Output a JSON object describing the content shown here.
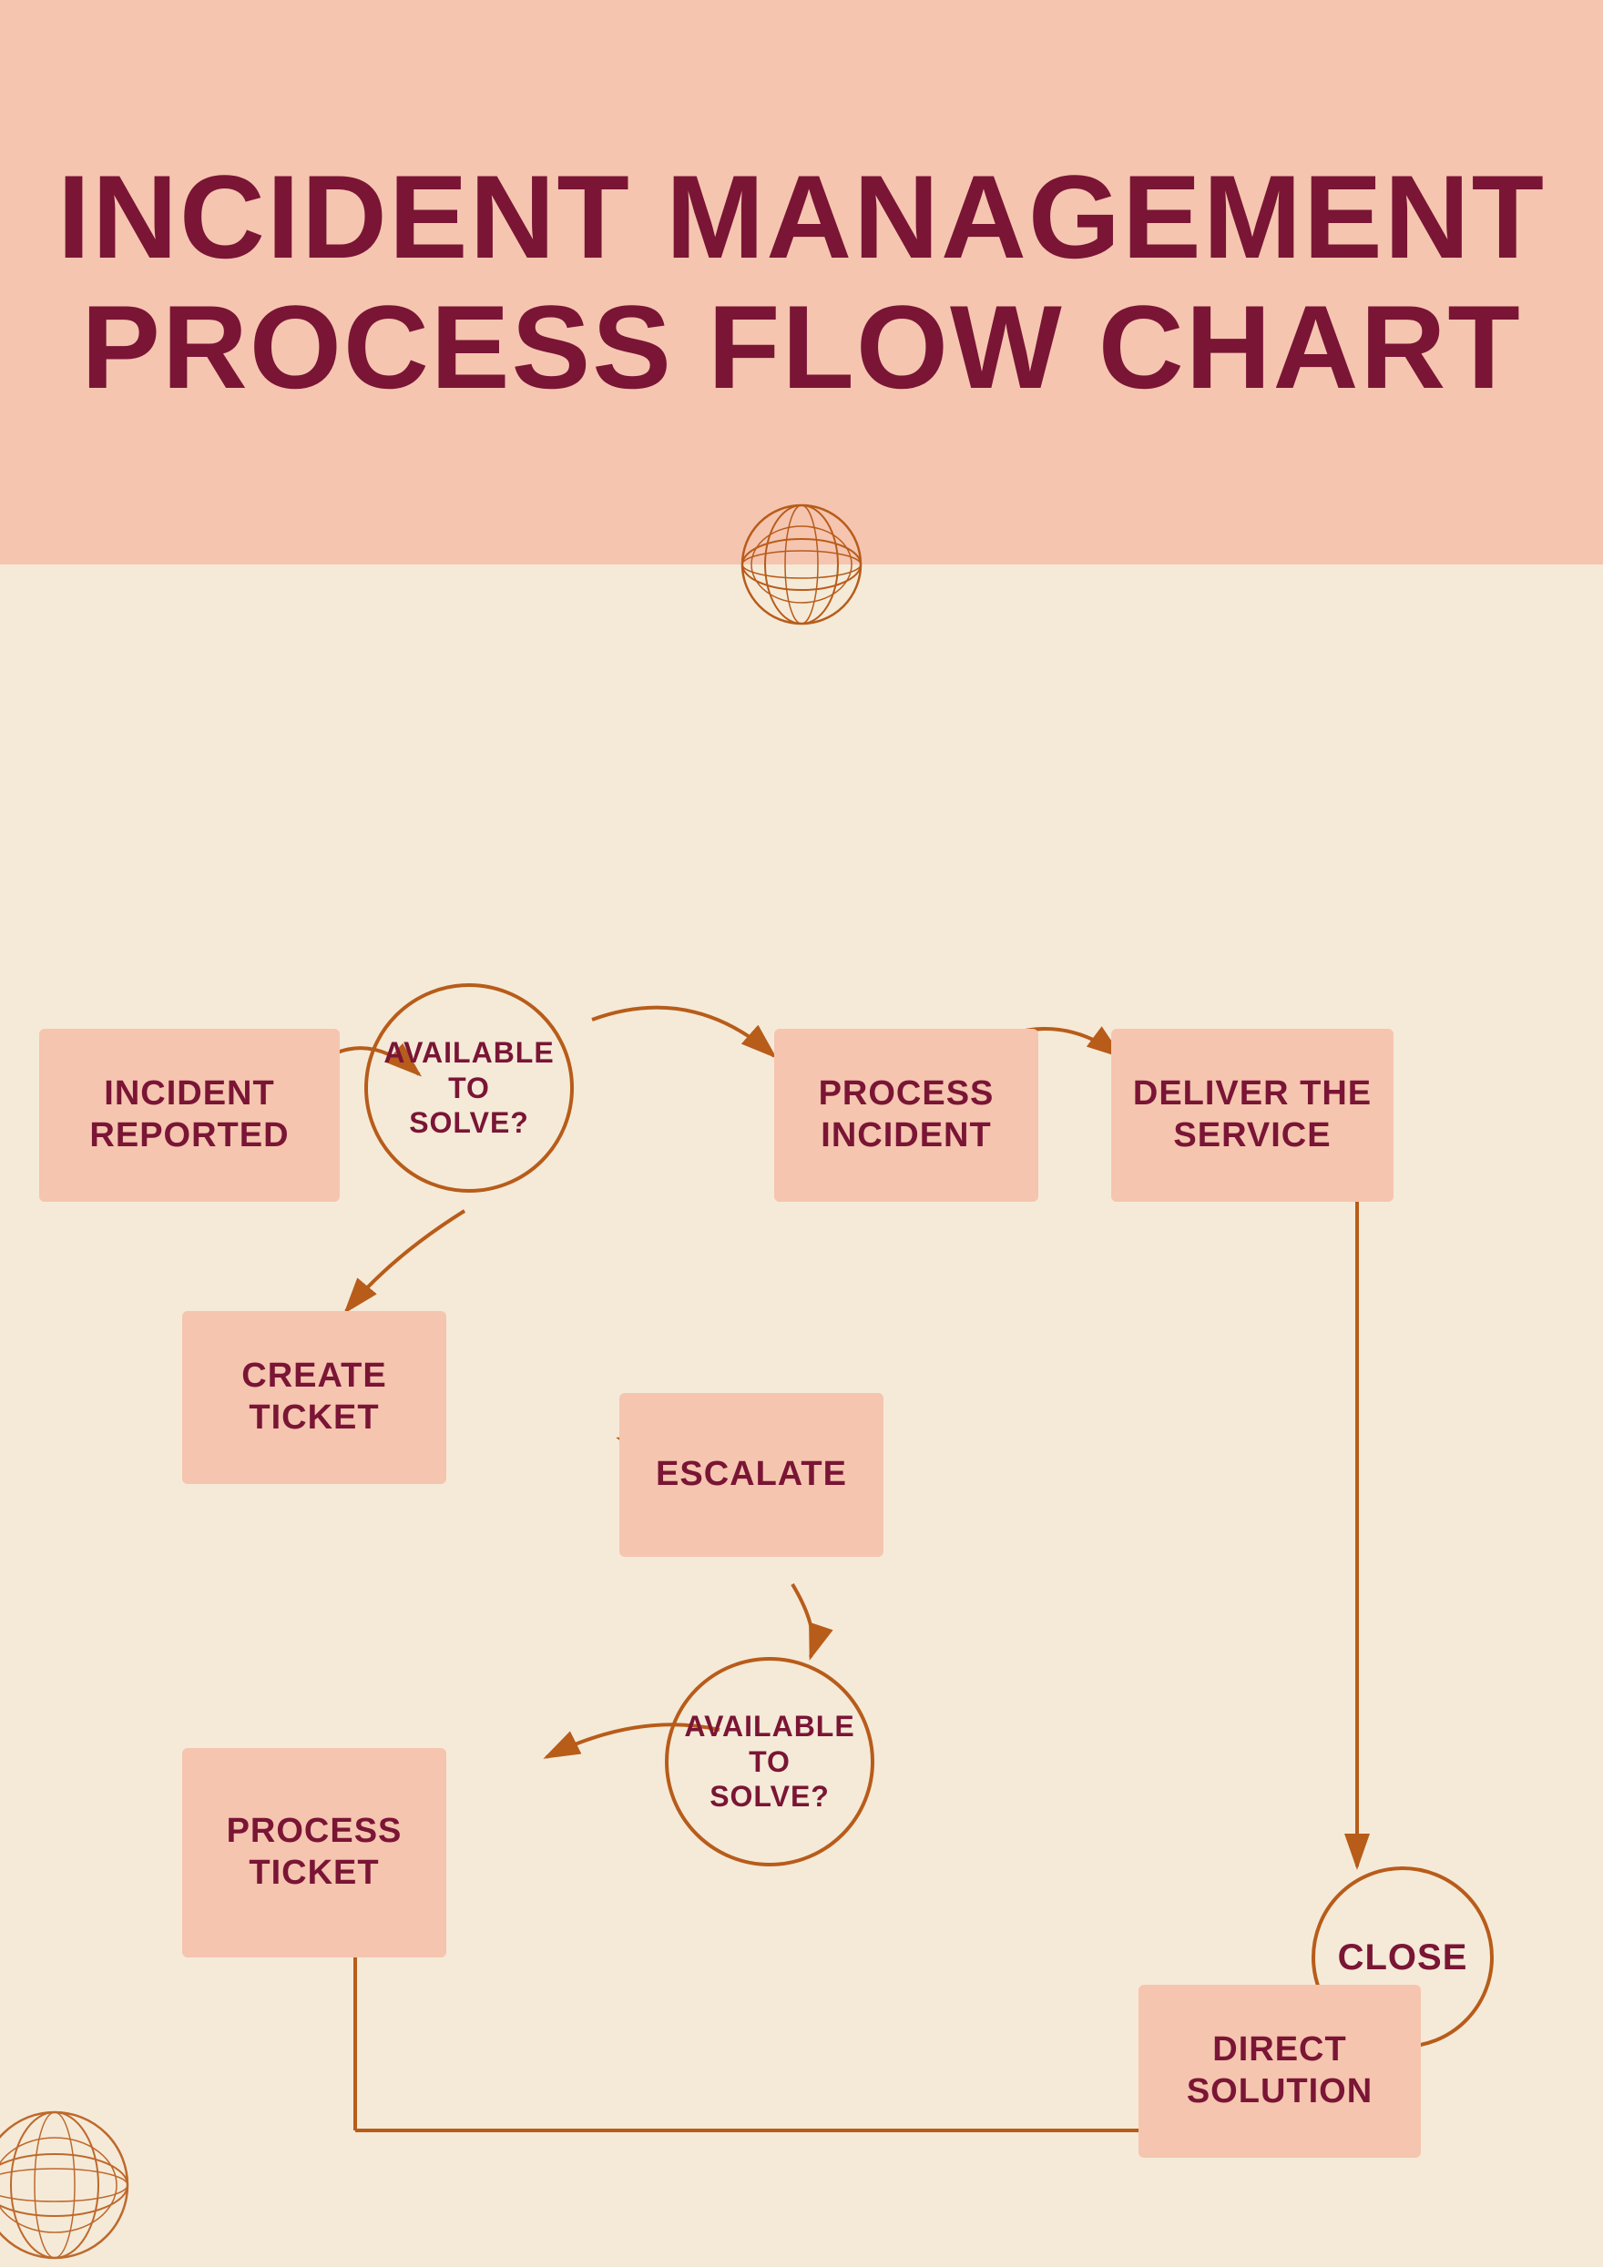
{
  "header": {
    "title": "INCIDENT MANAGEMENT PROCESS FLOW CHART",
    "background_color": "#f5c5b0",
    "title_color": "#7a1535"
  },
  "body": {
    "background_color": "#f5ead8"
  },
  "nodes": {
    "incident_reported": "INCIDENT REPORTED",
    "available_to_solve_1": "AVAILABLE TO SOLVE?",
    "process_incident": "PROCESS INCIDENT",
    "deliver_the_service": "DELIVER THE SERVICE",
    "create_ticket": "CREATE TICKET",
    "escalate": "ESCALATE",
    "close": "CLOSE",
    "process_ticket": "PROCESS TICKET",
    "available_to_solve_2": "AVAILABLE TO SOLVE?",
    "direct_solution": "DIRECT SOLUTION"
  },
  "colors": {
    "arrow_color": "#b85c1a",
    "node_bg": "#f5c5b0",
    "node_text": "#7a1535",
    "circle_border": "#b85c1a"
  }
}
